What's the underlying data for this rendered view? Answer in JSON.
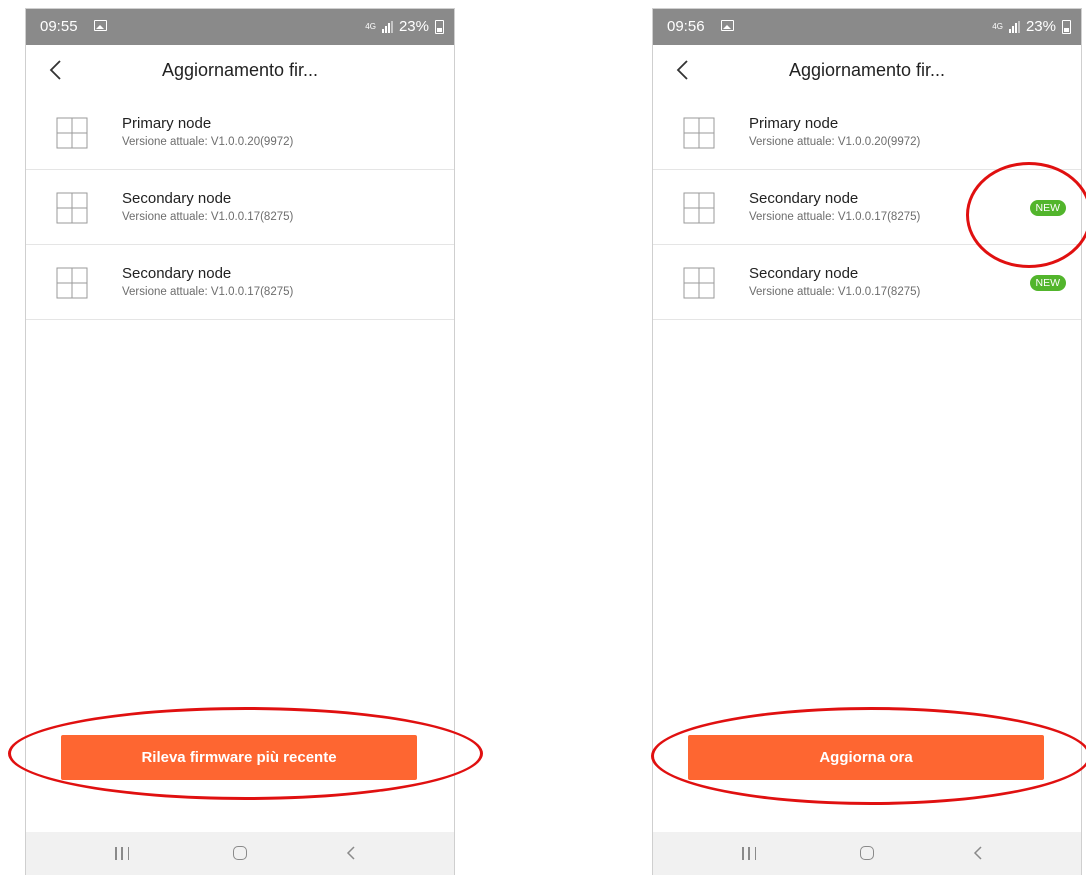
{
  "screens": [
    {
      "status": {
        "time": "09:55",
        "network": "4G",
        "battery": "23%"
      },
      "title": "Aggiornamento fir...",
      "nodes": [
        {
          "name": "Primary node",
          "version": "Versione attuale: V1.0.0.20(9972)"
        },
        {
          "name": "Secondary node",
          "version": "Versione attuale: V1.0.0.17(8275)"
        },
        {
          "name": "Secondary node",
          "version": "Versione attuale: V1.0.0.17(8275)"
        }
      ],
      "button_label": "Rileva firmware più recente"
    },
    {
      "status": {
        "time": "09:56",
        "network": "4G",
        "battery": "23%"
      },
      "title": "Aggiornamento fir...",
      "nodes": [
        {
          "name": "Primary node",
          "version": "Versione attuale: V1.0.0.20(9972)"
        },
        {
          "name": "Secondary node",
          "version": "Versione attuale: V1.0.0.17(8275)",
          "badge": "NEW"
        },
        {
          "name": "Secondary node",
          "version": "Versione attuale: V1.0.0.17(8275)",
          "badge": "NEW"
        }
      ],
      "button_label": "Aggiorna ora"
    }
  ],
  "colors": {
    "accent": "#fe6631",
    "badge": "#52b52c",
    "annotation": "#e01010",
    "statusbar": "#8a8a8a"
  },
  "icons": [
    "gallery-icon",
    "signal-icon",
    "battery-icon",
    "back-arrow-icon",
    "node-device-icon",
    "nav-recent-apps-icon",
    "nav-home-icon",
    "nav-back-icon"
  ]
}
